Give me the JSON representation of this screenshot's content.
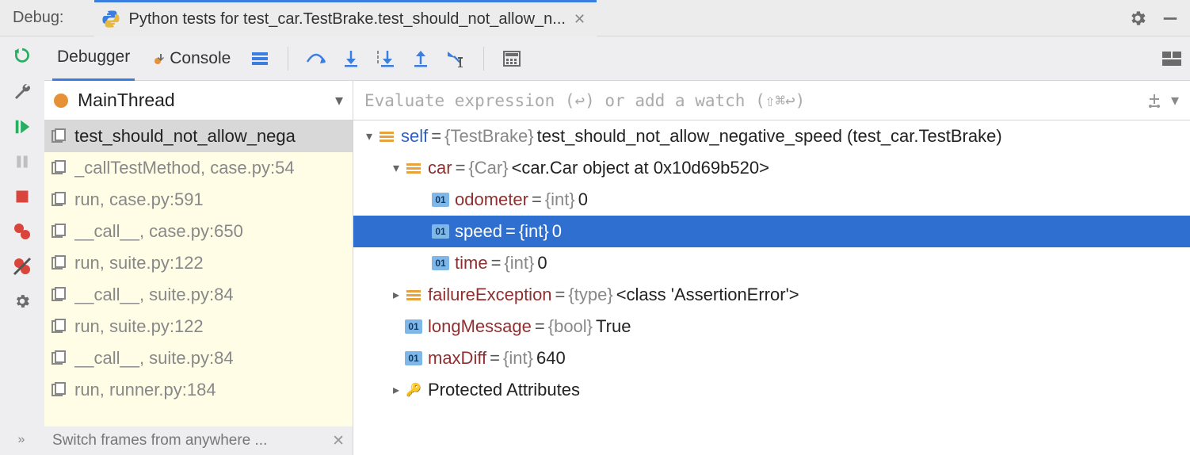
{
  "titlebar": {
    "debug_label": "Debug:",
    "tab_title": "Python tests for test_car.TestBrake.test_should_not_allow_n..."
  },
  "toolbar": {
    "debugger_tab": "Debugger",
    "console_tab": "Console"
  },
  "frames": {
    "thread_name": "MainThread",
    "items": [
      {
        "label": "test_should_not_allow_nega",
        "active": true
      },
      {
        "label": "_callTestMethod, case.py:54",
        "active": false
      },
      {
        "label": "run, case.py:591",
        "active": false
      },
      {
        "label": "__call__, case.py:650",
        "active": false
      },
      {
        "label": "run, suite.py:122",
        "active": false
      },
      {
        "label": "__call__, suite.py:84",
        "active": false
      },
      {
        "label": "run, suite.py:122",
        "active": false
      },
      {
        "label": "__call__, suite.py:84",
        "active": false
      },
      {
        "label": "run, runner.py:184",
        "active": false
      }
    ],
    "hint": "Switch frames from anywhere ..."
  },
  "watch": {
    "placeholder": "Evaluate expression (↩) or add a watch (⇧⌘↩)"
  },
  "vars": [
    {
      "indent": 0,
      "arrow": "down",
      "kind": "struct",
      "name": "self",
      "nameStyle": "link",
      "eq": " = ",
      "type": "{TestBrake} ",
      "val": "test_should_not_allow_negative_speed (test_car.TestBrake)",
      "selected": false
    },
    {
      "indent": 1,
      "arrow": "down",
      "kind": "struct",
      "name": "car",
      "nameStyle": "field",
      "eq": " = ",
      "type": "{Car} ",
      "val": "<car.Car object at 0x10d69b520>",
      "selected": false
    },
    {
      "indent": 2,
      "arrow": "none",
      "kind": "01",
      "name": "odometer",
      "nameStyle": "field",
      "eq": " = ",
      "type": "{int} ",
      "val": "0",
      "selected": false
    },
    {
      "indent": 2,
      "arrow": "none",
      "kind": "01",
      "name": "speed",
      "nameStyle": "field",
      "eq": " = ",
      "type": "{int} ",
      "val": "0",
      "selected": true
    },
    {
      "indent": 2,
      "arrow": "none",
      "kind": "01",
      "name": "time",
      "nameStyle": "field",
      "eq": " = ",
      "type": "{int} ",
      "val": "0",
      "selected": false
    },
    {
      "indent": 1,
      "arrow": "right",
      "kind": "struct",
      "name": "failureException",
      "nameStyle": "field",
      "eq": " = ",
      "type": "{type} ",
      "val": "<class 'AssertionError'>",
      "selected": false
    },
    {
      "indent": 1,
      "arrow": "none",
      "kind": "01",
      "name": "longMessage",
      "nameStyle": "field",
      "eq": " = ",
      "type": "{bool} ",
      "val": "True",
      "selected": false
    },
    {
      "indent": 1,
      "arrow": "none",
      "kind": "01",
      "name": "maxDiff",
      "nameStyle": "field",
      "eq": " = ",
      "type": "{int} ",
      "val": "640",
      "selected": false
    },
    {
      "indent": 1,
      "arrow": "right",
      "kind": "key",
      "name": "Protected Attributes",
      "nameStyle": "plain",
      "eq": "",
      "type": "",
      "val": "",
      "selected": false
    }
  ]
}
